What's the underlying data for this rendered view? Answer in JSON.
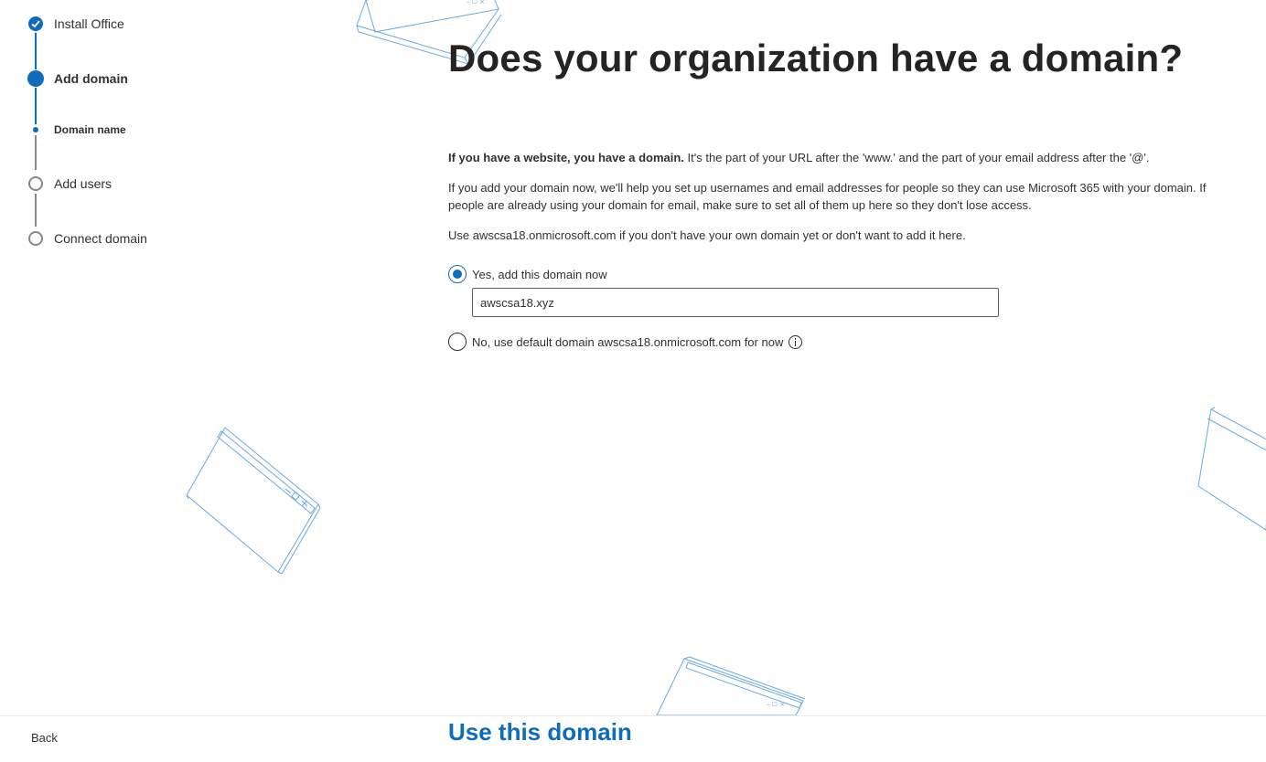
{
  "stepper": {
    "steps": [
      {
        "label": "Install Office",
        "state": "completed"
      },
      {
        "label": "Add domain",
        "state": "current"
      },
      {
        "label": "Domain name",
        "state": "current-substep"
      },
      {
        "label": "Add users",
        "state": "not-started"
      },
      {
        "label": "Connect domain",
        "state": "not-started"
      }
    ]
  },
  "main": {
    "title": "Does your organization have a domain?",
    "intro_bold": "If you have a website, you have a domain.",
    "intro_rest": " It's the part of your URL after the 'www.' and the part of your email address after the '@'.",
    "para2": "If you add your domain now, we'll help you set up usernames and email addresses for people so they can use Microsoft 365 with your domain. If people are already using your domain for email, make sure to set all of them up here so they don't lose access.",
    "para3": "Use awscsa18.onmicrosoft.com if you don't have your own domain yet or don't want to add it here.",
    "options": {
      "yes_label": "Yes, add this domain now",
      "yes_selected": true,
      "no_label": "No, use default domain awscsa18.onmicrosoft.com for now",
      "no_selected": false
    },
    "domain_input_value": "awscsa18.xyz"
  },
  "footer": {
    "back_label": "Back",
    "primary_label": "Use this domain"
  },
  "colors": {
    "accent": "#0f6cbd",
    "inactive": "#8a8886",
    "text": "#323130",
    "decoration": "#6aa9e0"
  },
  "icons": {
    "completed_step": "check-icon",
    "info": "info-icon"
  }
}
